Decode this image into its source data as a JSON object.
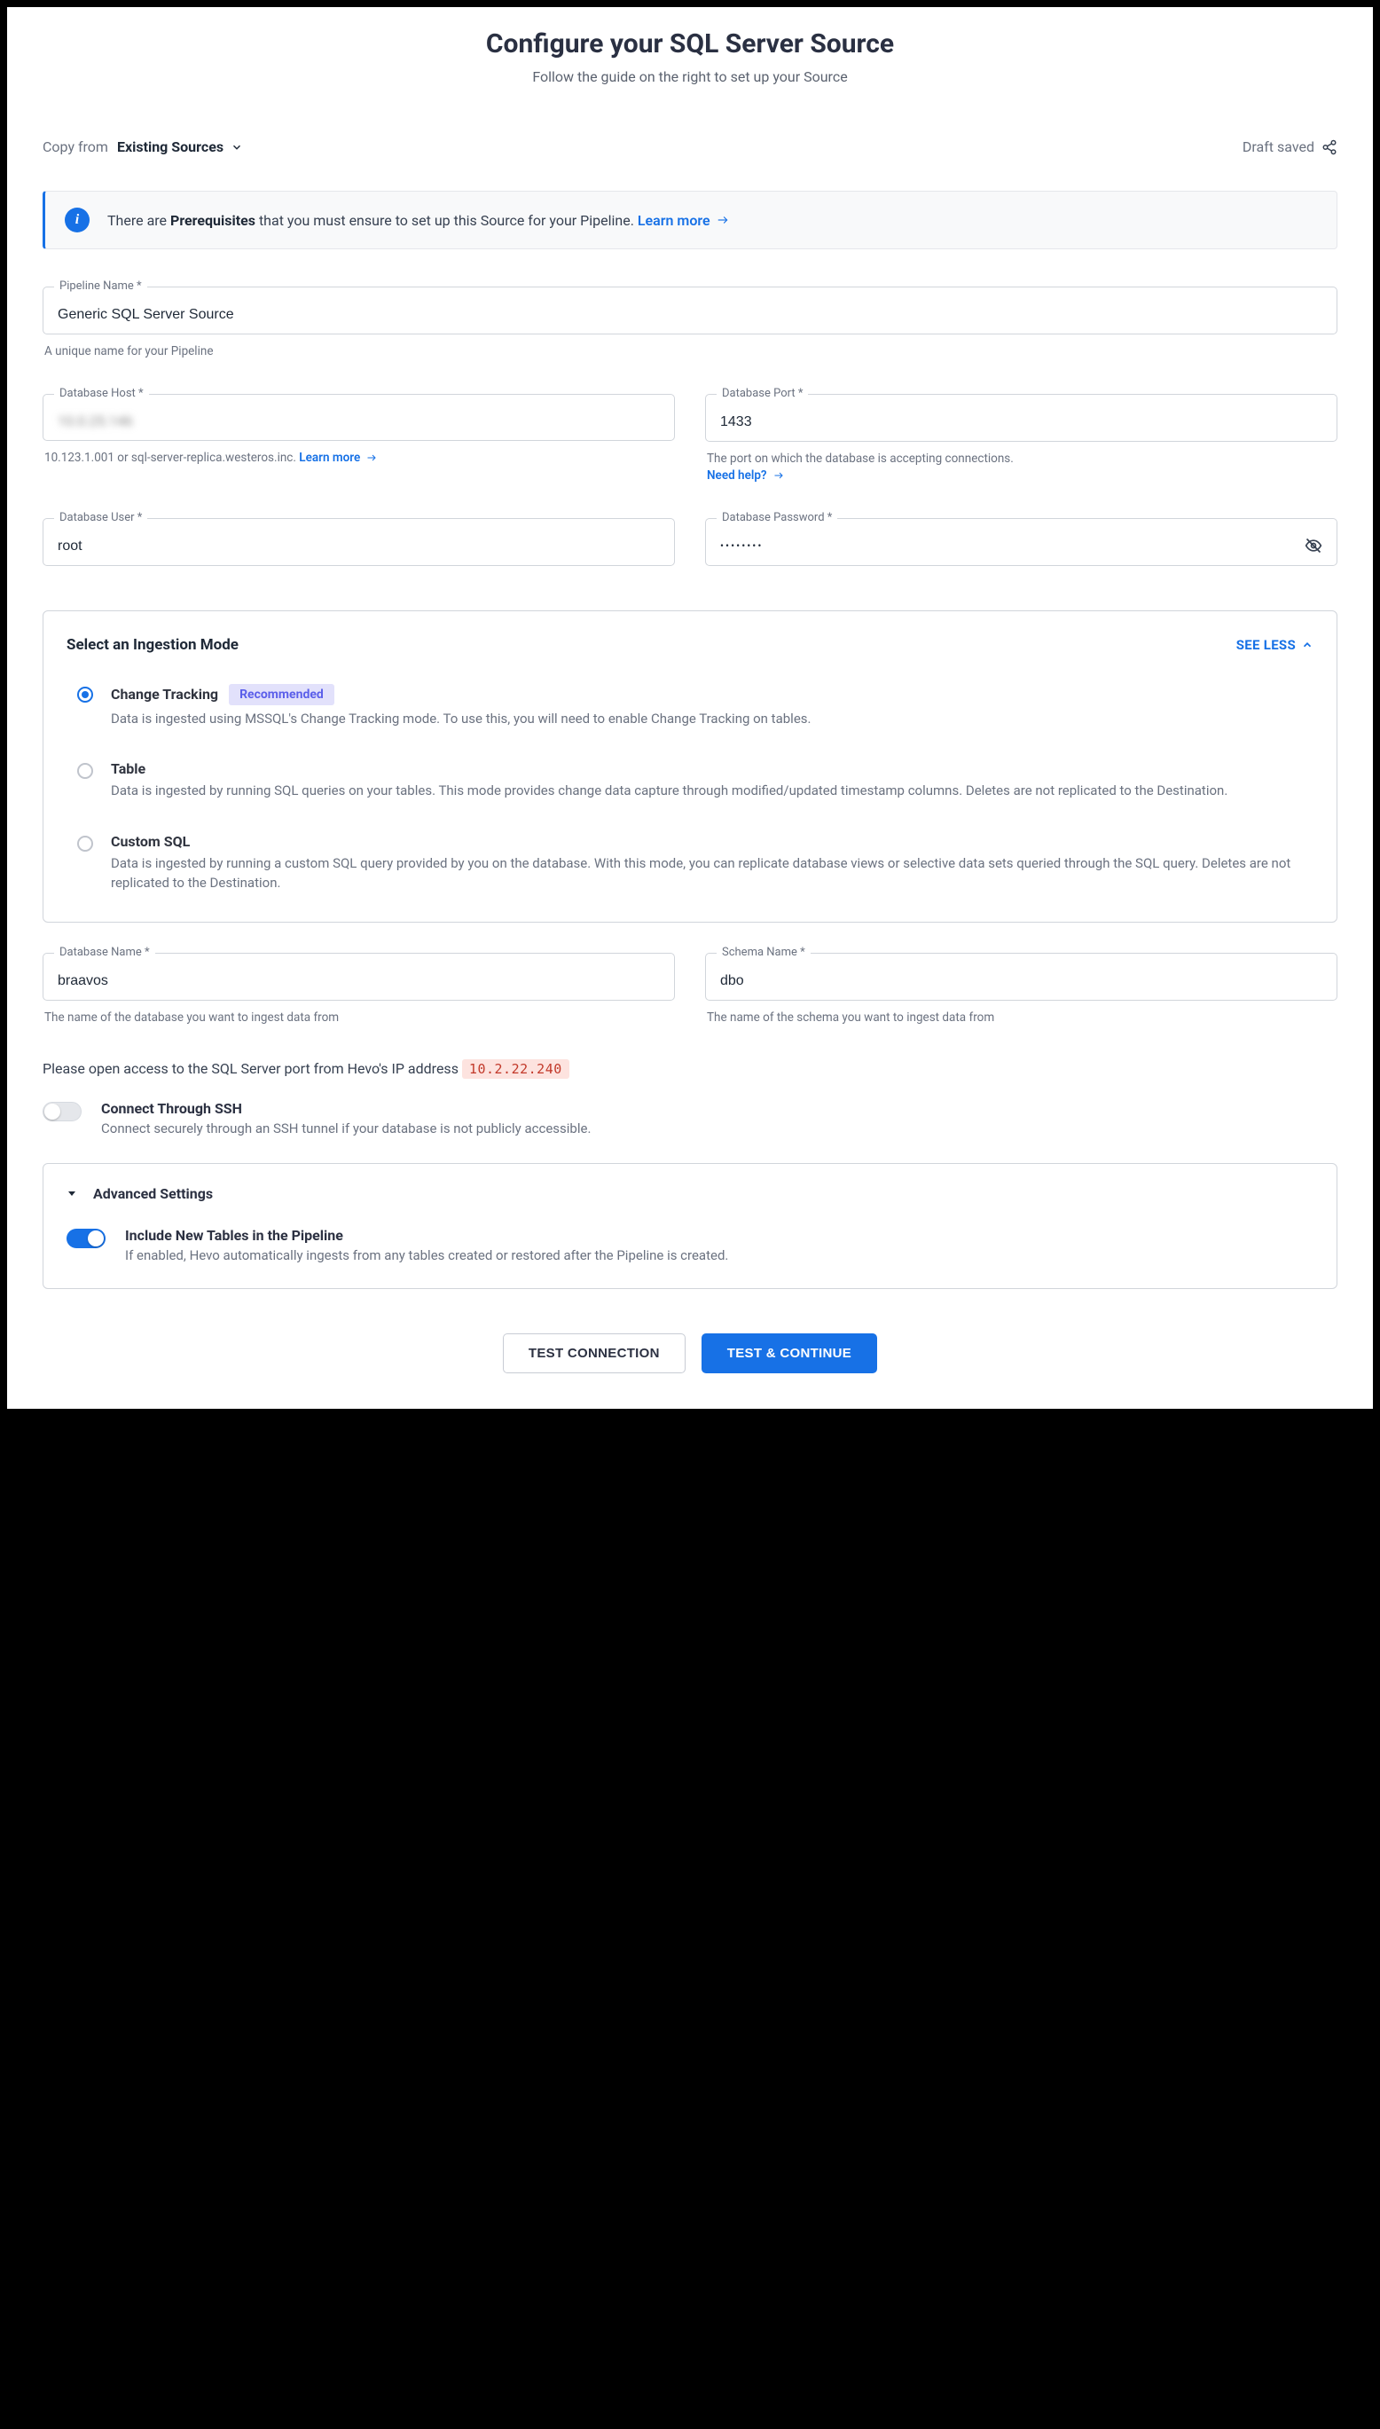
{
  "header": {
    "title": "Configure your SQL Server Source",
    "subtitle": "Follow the guide on the right to set up your Source"
  },
  "copy_from": {
    "label": "Copy from",
    "value": "Existing Sources"
  },
  "draft_saved": "Draft saved",
  "info_banner": {
    "prefix": "There are ",
    "bold": "Prerequisites",
    "suffix": " that you must ensure to set up this Source for your Pipeline.  ",
    "learn_more": "Learn more"
  },
  "fields": {
    "pipeline_name": {
      "label": "Pipeline Name *",
      "value": "Generic SQL Server Source",
      "help": "A unique name for your Pipeline"
    },
    "db_host": {
      "label": "Database Host *",
      "value": "10.0.25.146",
      "help_text": "10.123.1.001 or sql-server-replica.westeros.inc. ",
      "learn_more": "Learn more"
    },
    "db_port": {
      "label": "Database Port *",
      "value": "1433",
      "help_text": "The port on which the database is accepting connections.",
      "need_help": "Need help?"
    },
    "db_user": {
      "label": "Database User *",
      "value": "root"
    },
    "db_password": {
      "label": "Database Password *",
      "value": "••••••••"
    },
    "db_name": {
      "label": "Database Name *",
      "value": "braavos",
      "help": "The name of the database you want to ingest data from"
    },
    "schema_name": {
      "label": "Schema Name *",
      "value": "dbo",
      "help": "The name of the schema you want to ingest data from"
    }
  },
  "ingestion": {
    "title": "Select an Ingestion Mode",
    "see_less": "SEE LESS",
    "options": [
      {
        "title": "Change Tracking",
        "badge": "Recommended",
        "desc": "Data is ingested using MSSQL's Change Tracking mode. To use this, you will need to enable Change Tracking on tables.",
        "selected": true
      },
      {
        "title": "Table",
        "desc": "Data is ingested by running SQL queries on your tables. This mode provides change data capture through modified/updated timestamp columns. Deletes are not replicated to the Destination.",
        "selected": false
      },
      {
        "title": "Custom SQL",
        "desc": "Data is ingested by running a custom SQL query provided by you on the database. With this mode, you can replicate database views or selective data sets queried through the SQL query. Deletes are not replicated to the Destination.",
        "selected": false
      }
    ]
  },
  "ip_access": {
    "text": "Please open access to the SQL Server port from Hevo's IP address ",
    "ip": "10.2.22.240"
  },
  "ssh": {
    "title": "Connect Through SSH",
    "desc": "Connect securely through an SSH tunnel if your database is not publicly accessible."
  },
  "advanced": {
    "title": "Advanced Settings",
    "include_new": {
      "title": "Include New Tables in the Pipeline",
      "desc": "If enabled, Hevo automatically ingests from any tables created or restored after the Pipeline is created."
    }
  },
  "actions": {
    "test": "TEST CONNECTION",
    "continue": "TEST & CONTINUE"
  }
}
